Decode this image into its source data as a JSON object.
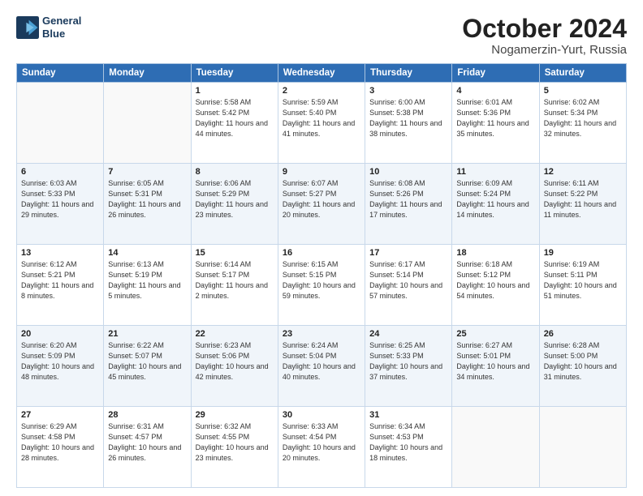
{
  "logo": {
    "line1": "General",
    "line2": "Blue"
  },
  "title": "October 2024",
  "location": "Nogamerzin-Yurt, Russia",
  "headers": [
    "Sunday",
    "Monday",
    "Tuesday",
    "Wednesday",
    "Thursday",
    "Friday",
    "Saturday"
  ],
  "weeks": [
    [
      {
        "day": "",
        "info": ""
      },
      {
        "day": "",
        "info": ""
      },
      {
        "day": "1",
        "info": "Sunrise: 5:58 AM\nSunset: 5:42 PM\nDaylight: 11 hours and 44 minutes."
      },
      {
        "day": "2",
        "info": "Sunrise: 5:59 AM\nSunset: 5:40 PM\nDaylight: 11 hours and 41 minutes."
      },
      {
        "day": "3",
        "info": "Sunrise: 6:00 AM\nSunset: 5:38 PM\nDaylight: 11 hours and 38 minutes."
      },
      {
        "day": "4",
        "info": "Sunrise: 6:01 AM\nSunset: 5:36 PM\nDaylight: 11 hours and 35 minutes."
      },
      {
        "day": "5",
        "info": "Sunrise: 6:02 AM\nSunset: 5:34 PM\nDaylight: 11 hours and 32 minutes."
      }
    ],
    [
      {
        "day": "6",
        "info": "Sunrise: 6:03 AM\nSunset: 5:33 PM\nDaylight: 11 hours and 29 minutes."
      },
      {
        "day": "7",
        "info": "Sunrise: 6:05 AM\nSunset: 5:31 PM\nDaylight: 11 hours and 26 minutes."
      },
      {
        "day": "8",
        "info": "Sunrise: 6:06 AM\nSunset: 5:29 PM\nDaylight: 11 hours and 23 minutes."
      },
      {
        "day": "9",
        "info": "Sunrise: 6:07 AM\nSunset: 5:27 PM\nDaylight: 11 hours and 20 minutes."
      },
      {
        "day": "10",
        "info": "Sunrise: 6:08 AM\nSunset: 5:26 PM\nDaylight: 11 hours and 17 minutes."
      },
      {
        "day": "11",
        "info": "Sunrise: 6:09 AM\nSunset: 5:24 PM\nDaylight: 11 hours and 14 minutes."
      },
      {
        "day": "12",
        "info": "Sunrise: 6:11 AM\nSunset: 5:22 PM\nDaylight: 11 hours and 11 minutes."
      }
    ],
    [
      {
        "day": "13",
        "info": "Sunrise: 6:12 AM\nSunset: 5:21 PM\nDaylight: 11 hours and 8 minutes."
      },
      {
        "day": "14",
        "info": "Sunrise: 6:13 AM\nSunset: 5:19 PM\nDaylight: 11 hours and 5 minutes."
      },
      {
        "day": "15",
        "info": "Sunrise: 6:14 AM\nSunset: 5:17 PM\nDaylight: 11 hours and 2 minutes."
      },
      {
        "day": "16",
        "info": "Sunrise: 6:15 AM\nSunset: 5:15 PM\nDaylight: 10 hours and 59 minutes."
      },
      {
        "day": "17",
        "info": "Sunrise: 6:17 AM\nSunset: 5:14 PM\nDaylight: 10 hours and 57 minutes."
      },
      {
        "day": "18",
        "info": "Sunrise: 6:18 AM\nSunset: 5:12 PM\nDaylight: 10 hours and 54 minutes."
      },
      {
        "day": "19",
        "info": "Sunrise: 6:19 AM\nSunset: 5:11 PM\nDaylight: 10 hours and 51 minutes."
      }
    ],
    [
      {
        "day": "20",
        "info": "Sunrise: 6:20 AM\nSunset: 5:09 PM\nDaylight: 10 hours and 48 minutes."
      },
      {
        "day": "21",
        "info": "Sunrise: 6:22 AM\nSunset: 5:07 PM\nDaylight: 10 hours and 45 minutes."
      },
      {
        "day": "22",
        "info": "Sunrise: 6:23 AM\nSunset: 5:06 PM\nDaylight: 10 hours and 42 minutes."
      },
      {
        "day": "23",
        "info": "Sunrise: 6:24 AM\nSunset: 5:04 PM\nDaylight: 10 hours and 40 minutes."
      },
      {
        "day": "24",
        "info": "Sunrise: 6:25 AM\nSunset: 5:33 PM\nDaylight: 10 hours and 37 minutes."
      },
      {
        "day": "25",
        "info": "Sunrise: 6:27 AM\nSunset: 5:01 PM\nDaylight: 10 hours and 34 minutes."
      },
      {
        "day": "26",
        "info": "Sunrise: 6:28 AM\nSunset: 5:00 PM\nDaylight: 10 hours and 31 minutes."
      }
    ],
    [
      {
        "day": "27",
        "info": "Sunrise: 6:29 AM\nSunset: 4:58 PM\nDaylight: 10 hours and 28 minutes."
      },
      {
        "day": "28",
        "info": "Sunrise: 6:31 AM\nSunset: 4:57 PM\nDaylight: 10 hours and 26 minutes."
      },
      {
        "day": "29",
        "info": "Sunrise: 6:32 AM\nSunset: 4:55 PM\nDaylight: 10 hours and 23 minutes."
      },
      {
        "day": "30",
        "info": "Sunrise: 6:33 AM\nSunset: 4:54 PM\nDaylight: 10 hours and 20 minutes."
      },
      {
        "day": "31",
        "info": "Sunrise: 6:34 AM\nSunset: 4:53 PM\nDaylight: 10 hours and 18 minutes."
      },
      {
        "day": "",
        "info": ""
      },
      {
        "day": "",
        "info": ""
      }
    ]
  ]
}
